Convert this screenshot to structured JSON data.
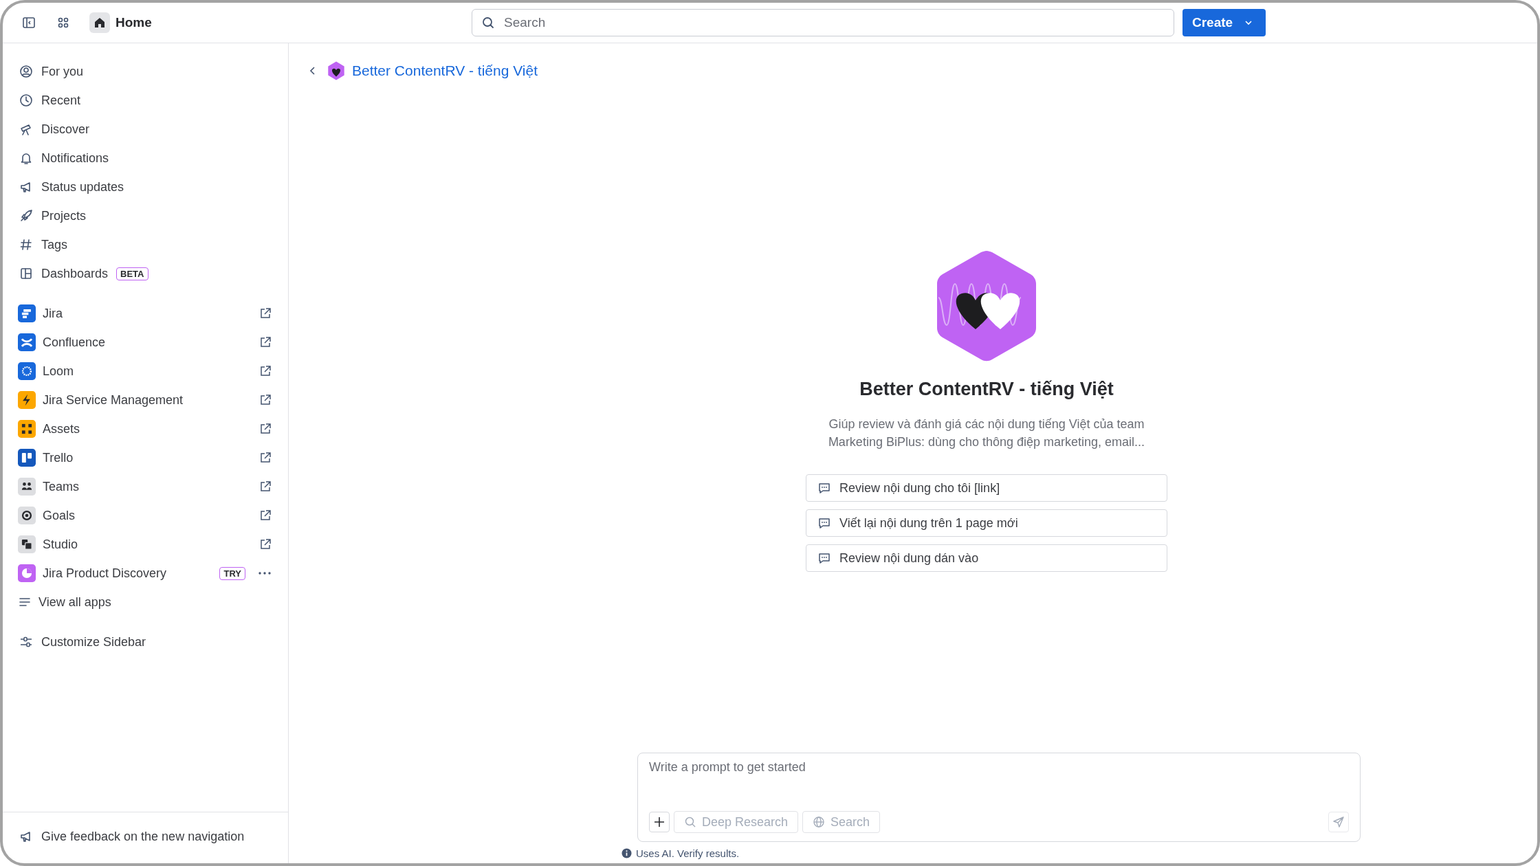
{
  "topbar": {
    "title": "Home",
    "search": {
      "placeholder": "Search"
    },
    "create_button": "Create"
  },
  "sidebar": {
    "nav_items": [
      {
        "label": "For you"
      },
      {
        "label": "Recent"
      },
      {
        "label": "Discover"
      },
      {
        "label": "Notifications"
      },
      {
        "label": "Status updates"
      },
      {
        "label": "Projects"
      },
      {
        "label": "Tags"
      },
      {
        "label": "Dashboards",
        "badge": "BETA"
      }
    ],
    "apps": [
      {
        "label": "Jira",
        "kind": "link"
      },
      {
        "label": "Confluence",
        "kind": "link"
      },
      {
        "label": "Loom",
        "kind": "link"
      },
      {
        "label": "Jira Service Management",
        "kind": "link"
      },
      {
        "label": "Assets",
        "kind": "link"
      },
      {
        "label": "Trello",
        "kind": "link"
      },
      {
        "label": "Teams",
        "kind": "link"
      },
      {
        "label": "Goals",
        "kind": "link"
      },
      {
        "label": "Studio",
        "kind": "link"
      },
      {
        "label": "Jira Product Discovery",
        "kind": "trial",
        "badge": "TRY"
      }
    ],
    "view_all": "View all apps",
    "customize": "Customize Sidebar",
    "feedback": "Give feedback on the new navigation"
  },
  "main": {
    "breadcrumb": "Better ContentRV - tiếng Việt",
    "agent": {
      "name": "Better ContentRV - tiếng Việt",
      "description": "Giúp review và đánh giá các nội dung tiếng Việt của team Marketing BiPlus: dùng cho thông điệp marketing, email...",
      "suggestions": [
        "Review nội dung cho tôi [link]",
        "Viết lại nội dung trên 1 page mới",
        "Review nội dung dán vào"
      ]
    },
    "prompt": {
      "placeholder": "Write a prompt to get started",
      "tools": [
        {
          "label": "Deep Research",
          "kind": "search",
          "disabled": true
        },
        {
          "label": "Search",
          "kind": "globe",
          "disabled": true
        }
      ]
    },
    "disclaimer": "Uses AI. Verify results."
  }
}
